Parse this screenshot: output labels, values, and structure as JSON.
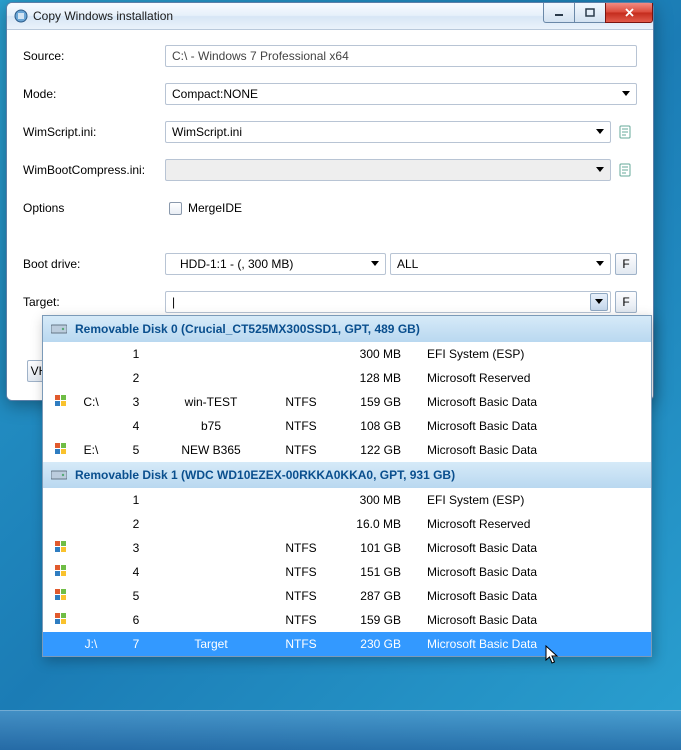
{
  "window": {
    "title": "Copy Windows installation"
  },
  "labels": {
    "source": "Source:",
    "mode": "Mode:",
    "wimscript": "WimScript.ini:",
    "wimboot": "WimBootCompress.ini:",
    "options": "Options",
    "bootdrive": "Boot drive:",
    "target": "Target:",
    "mergeide": "MergeIDE"
  },
  "values": {
    "source": "C:\\ - Windows 7 Professional x64",
    "mode": "Compact:NONE",
    "wimscript": "WimScript.ini",
    "wimboot": "",
    "bootdrive": "HDD-1:1 -   (, 300 MB)",
    "bootdrive_filter": "ALL",
    "target": "",
    "target_cursor": "|",
    "f_btn": "F",
    "vh_btn": "VH"
  },
  "disks": [
    {
      "header": "Removable Disk 0 (Crucial_CT525MX300SSD1, GPT, 489 GB)",
      "partitions": [
        {
          "icon": "",
          "drive": "",
          "index": "1",
          "label": "",
          "fs": "",
          "size": "300 MB",
          "type": "EFI System (ESP)",
          "selected": false
        },
        {
          "icon": "",
          "drive": "",
          "index": "2",
          "label": "",
          "fs": "",
          "size": "128 MB",
          "type": "Microsoft Reserved",
          "selected": false
        },
        {
          "icon": "win",
          "drive": "C:\\",
          "index": "3",
          "label": "win-TEST",
          "fs": "NTFS",
          "size": "159 GB",
          "type": "Microsoft Basic Data",
          "selected": false
        },
        {
          "icon": "",
          "drive": "",
          "index": "4",
          "label": "b75",
          "fs": "NTFS",
          "size": "108 GB",
          "type": "Microsoft Basic Data",
          "selected": false
        },
        {
          "icon": "win",
          "drive": "E:\\",
          "index": "5",
          "label": "NEW B365",
          "fs": "NTFS",
          "size": "122 GB",
          "type": "Microsoft Basic Data",
          "selected": false
        }
      ]
    },
    {
      "header": "Removable Disk 1 (WDC WD10EZEX-00RKKA0KKA0, GPT, 931 GB)",
      "partitions": [
        {
          "icon": "",
          "drive": "",
          "index": "1",
          "label": "",
          "fs": "",
          "size": "300 MB",
          "type": "EFI System (ESP)",
          "selected": false
        },
        {
          "icon": "",
          "drive": "",
          "index": "2",
          "label": "",
          "fs": "",
          "size": "16.0 MB",
          "type": "Microsoft Reserved",
          "selected": false
        },
        {
          "icon": "win",
          "drive": "",
          "index": "3",
          "label": "",
          "fs": "NTFS",
          "size": "101 GB",
          "type": "Microsoft Basic Data",
          "selected": false
        },
        {
          "icon": "win",
          "drive": "",
          "index": "4",
          "label": "",
          "fs": "NTFS",
          "size": "151 GB",
          "type": "Microsoft Basic Data",
          "selected": false
        },
        {
          "icon": "win",
          "drive": "",
          "index": "5",
          "label": "",
          "fs": "NTFS",
          "size": "287 GB",
          "type": "Microsoft Basic Data",
          "selected": false
        },
        {
          "icon": "win",
          "drive": "",
          "index": "6",
          "label": "",
          "fs": "NTFS",
          "size": "159 GB",
          "type": "Microsoft Basic Data",
          "selected": false
        },
        {
          "icon": "",
          "drive": "J:\\",
          "index": "7",
          "label": "Target",
          "fs": "NTFS",
          "size": "230 GB",
          "type": "Microsoft Basic Data",
          "selected": true
        }
      ]
    }
  ]
}
